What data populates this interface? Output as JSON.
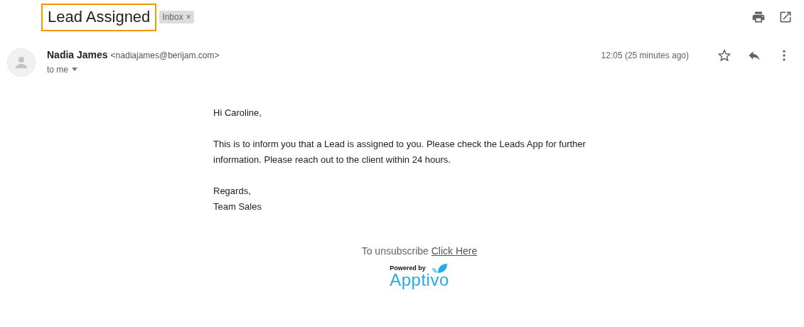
{
  "subject": {
    "title": "Lead Assigned",
    "highlighted": true,
    "label": "Inbox",
    "label_remove": "×"
  },
  "message": {
    "sender_name": "Nadia James",
    "sender_email": "<nadiajames@berijam.com>",
    "recipient": "to me",
    "time": "12:05 (25 minutes ago)",
    "starred": false
  },
  "body": {
    "paragraphs": [
      [
        "Hi Caroline,"
      ],
      [
        "This is to inform you that a Lead is assigned to you. Please check the Leads App for further information. Please reach out to the client within 24 hours."
      ],
      [
        "Regards,",
        "Team Sales"
      ]
    ]
  },
  "footer": {
    "unsubscribe_text": "To unsubscribe",
    "unsubscribe_link": "Click Here",
    "powered_by": "Powered by",
    "brand": "Apptivo"
  }
}
